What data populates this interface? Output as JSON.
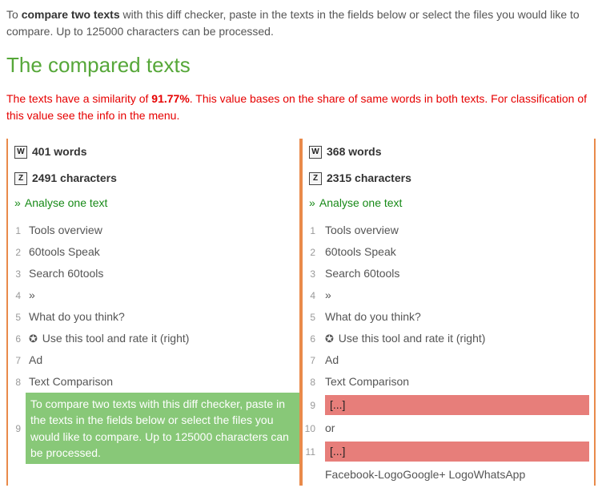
{
  "intro": {
    "prefix": "To ",
    "bold": "compare two texts",
    "suffix": " with this diff checker, paste in the texts in the fields below or select the files you would like to compare. Up to 125000 characters can be processed."
  },
  "heading": "The compared texts",
  "similarity": {
    "prefix": "The texts have a similarity of ",
    "value": "91.77%",
    "suffix": ". This value bases on the share of same words in both texts. For classification of this value see the info in the menu."
  },
  "left": {
    "words_icon": "W",
    "words": "401 words",
    "chars_icon": "Z",
    "chars": "2491 characters",
    "analyse_arrows": "»",
    "analyse_label": "Analyse one text",
    "lines": [
      {
        "n": "1",
        "t": "Tools overview"
      },
      {
        "n": "2",
        "t": "60tools Speak"
      },
      {
        "n": "3",
        "t": "Search 60tools"
      },
      {
        "n": "4",
        "t": "»"
      },
      {
        "n": "5",
        "t": "What do you think?"
      },
      {
        "n": "6",
        "gear": true,
        "t": "Use this tool and rate it (right)"
      },
      {
        "n": "7",
        "t": "Ad"
      },
      {
        "n": "8",
        "t": "Text Comparison"
      },
      {
        "n": "9",
        "hl": "green",
        "t": "To compare two texts with this diff checker, paste in the texts in the fields below or select the files you would like to compare. Up to 125000 characters can be processed."
      }
    ]
  },
  "right": {
    "words_icon": "W",
    "words": "368 words",
    "chars_icon": "Z",
    "chars": "2315 characters",
    "analyse_arrows": "»",
    "analyse_label": "Analyse one text",
    "lines": [
      {
        "n": "1",
        "t": "Tools overview"
      },
      {
        "n": "2",
        "t": "60tools Speak"
      },
      {
        "n": "3",
        "t": "Search 60tools"
      },
      {
        "n": "4",
        "t": "»"
      },
      {
        "n": "5",
        "t": "What do you think?"
      },
      {
        "n": "6",
        "gear": true,
        "t": "Use this tool and rate it (right)"
      },
      {
        "n": "7",
        "t": "Ad"
      },
      {
        "n": "8",
        "t": "Text Comparison"
      },
      {
        "n": "9",
        "hl": "red",
        "t": "[...]"
      },
      {
        "n": "10",
        "t": "or"
      },
      {
        "n": "11",
        "hl": "red",
        "t": "[...]"
      },
      {
        "n": "",
        "t": "Facebook-LogoGoogle+ LogoWhatsApp"
      }
    ]
  },
  "gear_glyph": "✪"
}
